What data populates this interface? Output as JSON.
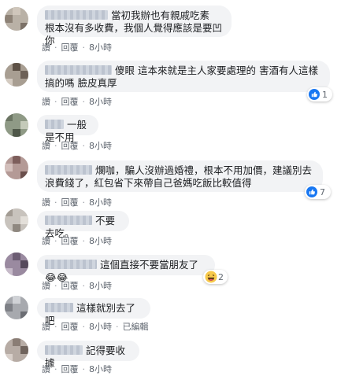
{
  "actions": {
    "like": "讚",
    "reply": "回覆",
    "separator": "·"
  },
  "comments": [
    {
      "text": "當初我辦也有親戚吃素\n根本沒有多收費，我個人覺得應該是要凹你",
      "time": "8小時"
    },
    {
      "text": "傻眼 這本來就是主人家要處理的 害酒有人這樣搞的嗎 臉皮真厚",
      "time": "8小時",
      "reaction_count": "1",
      "reaction_icon": "like-icon"
    },
    {
      "text": "一般是不用",
      "time": "8小時"
    },
    {
      "text": "爛咖，騙人沒辦過婚禮，根本不用加價，建議別去浪費錢了，紅包省下來帶自己爸媽吃飯比較值得",
      "time": "8小時",
      "reaction_count": "7",
      "reaction_icon": "like-icon"
    },
    {
      "text": "不要去吃。",
      "time": "8小時"
    },
    {
      "text": "這個直接不要當朋友了😂😂",
      "time": "8小時",
      "reaction_count": "2",
      "reaction_icon": "laugh-icon"
    },
    {
      "text": "這樣就別去了吧",
      "time": "8小時",
      "edited": "已編輯"
    },
    {
      "text": "記得要收據",
      "time": "8小時"
    }
  ],
  "colors": {
    "link_gray": "#606770",
    "bubble_bg": "#f2f3f5",
    "like_blue": "#1877f2"
  }
}
